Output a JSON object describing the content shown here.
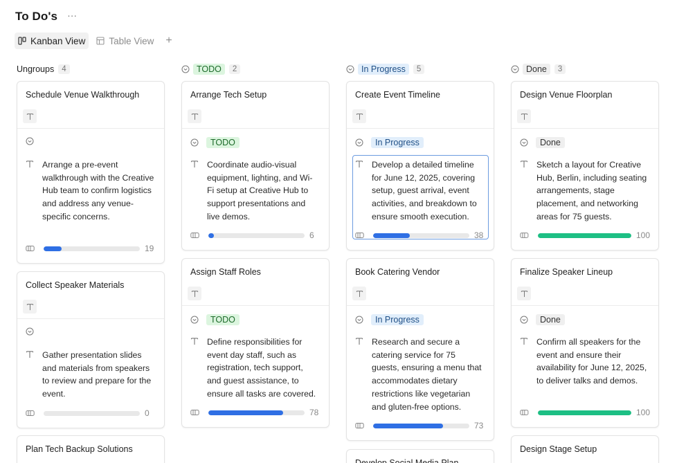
{
  "page": {
    "title": "To Do's",
    "more_label": "···"
  },
  "views": [
    {
      "label": "Kanban View",
      "icon": "kanban-icon",
      "active": true
    },
    {
      "label": "Table View",
      "icon": "table-icon",
      "active": false
    }
  ],
  "add_view_label": "+",
  "colors": {
    "blue": "#2f6fe4",
    "green": "#1dbf84",
    "todo_bg": "#dcf5df",
    "todo_fg": "#1d6b2a",
    "progress_bg": "#e1eefb",
    "progress_fg": "#1f4f86",
    "done_bg": "#efefef",
    "done_fg": "#333333"
  },
  "columns": [
    {
      "label": "Ungroups",
      "count": "4",
      "style": "plain",
      "cards": [
        {
          "title": "Schedule Venue Walkthrough",
          "status": "",
          "description": "Arrange a pre-event walkthrough with the Creative Hub team to confirm logistics and address any venue-specific concerns.",
          "progress": 19,
          "progress_label": "19"
        },
        {
          "title": "Collect Speaker Materials",
          "status": "",
          "description": "Gather presentation slides and materials from speakers to review and prepare for the event.",
          "progress": 0,
          "progress_label": "0"
        },
        {
          "title": "Plan Tech Backup Solutions",
          "status": "",
          "description": "",
          "progress": null,
          "progress_label": ""
        }
      ]
    },
    {
      "label": "TODO",
      "count": "2",
      "style": "todo",
      "cards": [
        {
          "title": "Arrange Tech Setup",
          "status": "TODO",
          "description": "Coordinate audio-visual equipment, lighting, and Wi-Fi setup at Creative Hub to support presentations and live demos.",
          "progress": 6,
          "progress_label": "6"
        },
        {
          "title": "Assign Staff Roles",
          "status": "TODO",
          "description": "Define responsibilities for event day staff, such as registration, tech support, and guest assistance, to ensure all tasks are covered.",
          "progress": 78,
          "progress_label": "78"
        }
      ]
    },
    {
      "label": "In Progress",
      "count": "5",
      "style": "progress",
      "cards": [
        {
          "title": "Create Event Timeline",
          "status": "In Progress",
          "description": "Develop a detailed timeline for June 12, 2025, covering setup, guest arrival, event activities, and breakdown to ensure smooth execution.",
          "progress": 38,
          "progress_label": "38",
          "selected": true
        },
        {
          "title": "Book Catering Vendor",
          "status": "In Progress",
          "description": "Research and secure a catering service for 75 guests, ensuring a menu that accommodates dietary restrictions like vegetarian and gluten-free options.",
          "progress": 73,
          "progress_label": "73"
        },
        {
          "title": "Develop Social Media Plan",
          "status": "",
          "description": "",
          "progress": null,
          "progress_label": ""
        }
      ]
    },
    {
      "label": "Done",
      "count": "3",
      "style": "done",
      "cards": [
        {
          "title": "Design Venue Floorplan",
          "status": "Done",
          "description": "Sketch a layout for Creative Hub, Berlin, including seating arrangements, stage placement, and networking areas for 75 guests.",
          "progress": 100,
          "progress_label": "100"
        },
        {
          "title": "Finalize Speaker Lineup",
          "status": "Done",
          "description": "Confirm all speakers for the event and ensure their availability for June 12, 2025, to deliver talks and demos.",
          "progress": 100,
          "progress_label": "100"
        },
        {
          "title": "Design Stage Setup",
          "status": "",
          "description": "",
          "progress": null,
          "progress_label": ""
        }
      ]
    }
  ]
}
